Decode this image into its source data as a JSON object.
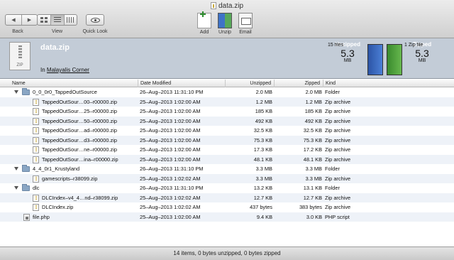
{
  "window": {
    "title": "data.zip"
  },
  "toolbar": {
    "back_label": "Back",
    "view_label": "View",
    "quicklook_label": "Quick Look",
    "actions": [
      {
        "label": "Add",
        "icon": "add-file-icon"
      },
      {
        "label": "Unzip",
        "icon": "unzip-icon"
      },
      {
        "label": "Email",
        "icon": "email-icon"
      }
    ]
  },
  "archive": {
    "name": "data.zip",
    "location_prefix": "In",
    "location": "Malayalis Corner",
    "icon_label": "ZIP",
    "unzipped": {
      "title": "Unzipped",
      "value": "5.3",
      "unit": "MB",
      "count": "15 files",
      "color": "#3f73c7"
    },
    "zipped": {
      "title": "Zipped",
      "value": "5.3",
      "unit": "MB",
      "count": "1 Zip file",
      "color": "#58a85a"
    }
  },
  "table": {
    "columns": [
      "Name",
      "Date Modified",
      "Unzipped",
      "Zipped",
      "Kind"
    ],
    "rows": [
      {
        "name": "0_0_0r0_TappedOutSource",
        "date": "26–Aug–2013 11:31:10 PM",
        "unzipped": "2.0 MB",
        "zipped": "2.0 MB",
        "kind": "Folder"
      },
      {
        "name": "TappedOutSour…00–r00000.zip",
        "date": "25–Aug–2013 1:02:00 AM",
        "unzipped": "1.2 MB",
        "zipped": "1.2 MB",
        "kind": "Zip archive"
      },
      {
        "name": "TappedOutSour…25–r00000.zip",
        "date": "25–Aug–2013 1:02:00 AM",
        "unzipped": "185 KB",
        "zipped": "185 KB",
        "kind": "Zip archive"
      },
      {
        "name": "TappedOutSour…50–r00000.zip",
        "date": "25–Aug–2013 1:02:00 AM",
        "unzipped": "492 KB",
        "zipped": "492 KB",
        "kind": "Zip archive"
      },
      {
        "name": "TappedOutSour…ad–r00000.zip",
        "date": "25–Aug–2013 1:02:00 AM",
        "unzipped": "32.5 KB",
        "zipped": "32.5 KB",
        "kind": "Zip archive"
      },
      {
        "name": "TappedOutSour…d3–r00000.zip",
        "date": "25–Aug–2013 1:02:00 AM",
        "unzipped": "75.3 KB",
        "zipped": "75.3 KB",
        "kind": "Zip archive"
      },
      {
        "name": "TappedOutSour…ne–r00000.zip",
        "date": "25–Aug–2013 1:02:00 AM",
        "unzipped": "17.3 KB",
        "zipped": "17.2 KB",
        "kind": "Zip archive"
      },
      {
        "name": "TappedOutSour…ina–r00000.zip",
        "date": "25–Aug–2013 1:02:00 AM",
        "unzipped": "48.1 KB",
        "zipped": "48.1 KB",
        "kind": "Zip archive"
      },
      {
        "name": "4_4_0r1_Krustyland",
        "date": "26–Aug–2013 11:31:10 PM",
        "unzipped": "3.3 MB",
        "zipped": "3.3 MB",
        "kind": "Folder"
      },
      {
        "name": "gamescripts–r38099.zip",
        "date": "25–Aug–2013 1:02:02 AM",
        "unzipped": "3.3 MB",
        "zipped": "3.3 MB",
        "kind": "Zip archive"
      },
      {
        "name": "dlc",
        "date": "26–Aug–2013 11:31:10 PM",
        "unzipped": "13.2 KB",
        "zipped": "13.1 KB",
        "kind": "Folder"
      },
      {
        "name": "DLCIndex–v4_4…nd–r38099.zip",
        "date": "25–Aug–2013 1:02:02 AM",
        "unzipped": "12.7 KB",
        "zipped": "12.7 KB",
        "kind": "Zip archive"
      },
      {
        "name": "DLCIndex.zip",
        "date": "25–Aug–2013 1:02:02 AM",
        "unzipped": "437 bytes",
        "zipped": "383 bytes",
        "kind": "Zip archive"
      },
      {
        "name": "file.php",
        "date": "25–Aug–2013 1:02:00 AM",
        "unzipped": "9.4 KB",
        "zipped": "3.0 KB",
        "kind": "PHP script"
      }
    ]
  },
  "status": {
    "text": "14 items, 0 bytes unzipped, 0 bytes zipped"
  }
}
